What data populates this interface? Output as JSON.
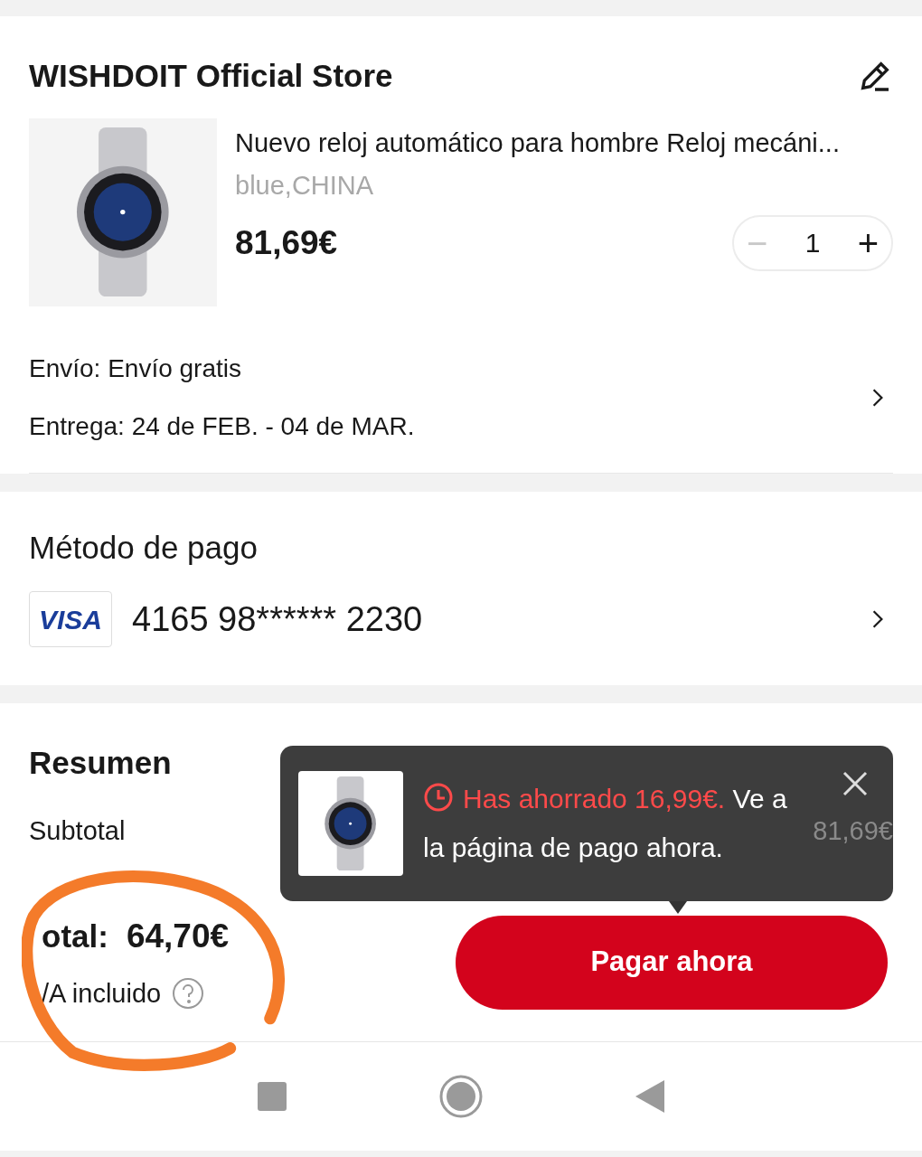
{
  "store": {
    "name": "WISHDOIT Official Store",
    "product": {
      "title": "Nuevo reloj automático para hombre Reloj mecáni...",
      "variant": "blue,CHINA",
      "price": "81,69€",
      "quantity": "1",
      "minus": "−",
      "plus": "+",
      "minus_disabled": true
    },
    "shipping": "Envío: Envío gratis",
    "delivery": "Entrega: 24 de FEB. - 04 de MAR."
  },
  "payment": {
    "title": "Método de pago",
    "card_brand": "VISA",
    "card_number": "4165 98****** 2230"
  },
  "summary": {
    "title": "Resumen",
    "subtotal_label": "Subtotal",
    "subtotal_value": "81,69€"
  },
  "toast": {
    "highlight": "Has ahorrado 16,99€.",
    "message": "Ve a la página de pago ahora."
  },
  "footer": {
    "total_label": "otal:",
    "total_value": "64,70€",
    "tax_note": "/A incluido",
    "pay_button": "Pagar ahora"
  }
}
